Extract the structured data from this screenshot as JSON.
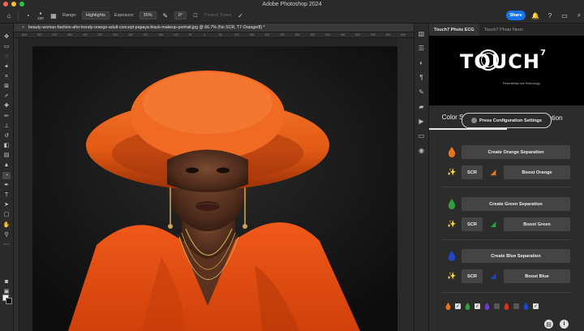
{
  "window": {
    "title": "Adobe Photoshop 2024",
    "traffic_colors": [
      "#ff5f57",
      "#febc2e",
      "#28c840"
    ]
  },
  "options_bar": {
    "brush_size": "220",
    "range_label": "Range:",
    "range_value": "Highlights",
    "exposure_label": "Exposure:",
    "exposure_value": "35%",
    "angle_value": "0°",
    "protect_tones": "Protect Tones",
    "share_label": "Share"
  },
  "document": {
    "tab_title": "beauty-woman-fashion-afro-trendy-orange-adult-concept-papaya-black-makeup-portrait.jpg @ 66.7% (No SCR, T7-Orange/8) *",
    "ruler_ticks": [
      "600",
      "550",
      "500",
      "450",
      "400",
      "350",
      "300",
      "250",
      "200",
      "150",
      "100",
      "50",
      "0",
      "50",
      "100",
      "150",
      "200",
      "250",
      "300",
      "350",
      "400",
      "450",
      "500",
      "550",
      "600",
      "650"
    ]
  },
  "panel": {
    "tabs": [
      {
        "label": "Touch7 Photo ECG",
        "active": true
      },
      {
        "label": "Touch7 Photo Neon",
        "active": false
      }
    ],
    "logo_text": "TOUCH",
    "logo_sup": "7",
    "logo_sub": "Reversibility-free Technology",
    "sub_tabs": [
      {
        "label": "Color Separations",
        "active": true
      },
      {
        "label": "Registration",
        "active": false
      }
    ],
    "config_button": "Press Configuration Settings",
    "sections": [
      {
        "color": "#e8751a",
        "create_label": "Create Orange Separation",
        "scr_label": "SCR",
        "boost_label": "Boost Orange"
      },
      {
        "color": "#2e9e3e",
        "create_label": "Create Green Separation",
        "scr_label": "SCR",
        "boost_label": "Boost Green"
      },
      {
        "color": "#1e44c8",
        "create_label": "Create Blue Separation",
        "scr_label": "SCR",
        "boost_label": "Boost Blue"
      }
    ],
    "bottom_colors": [
      "#e8751a",
      "#2e9e3e",
      "#6a3cc8",
      "#d8341e",
      "#1e44c8"
    ]
  }
}
